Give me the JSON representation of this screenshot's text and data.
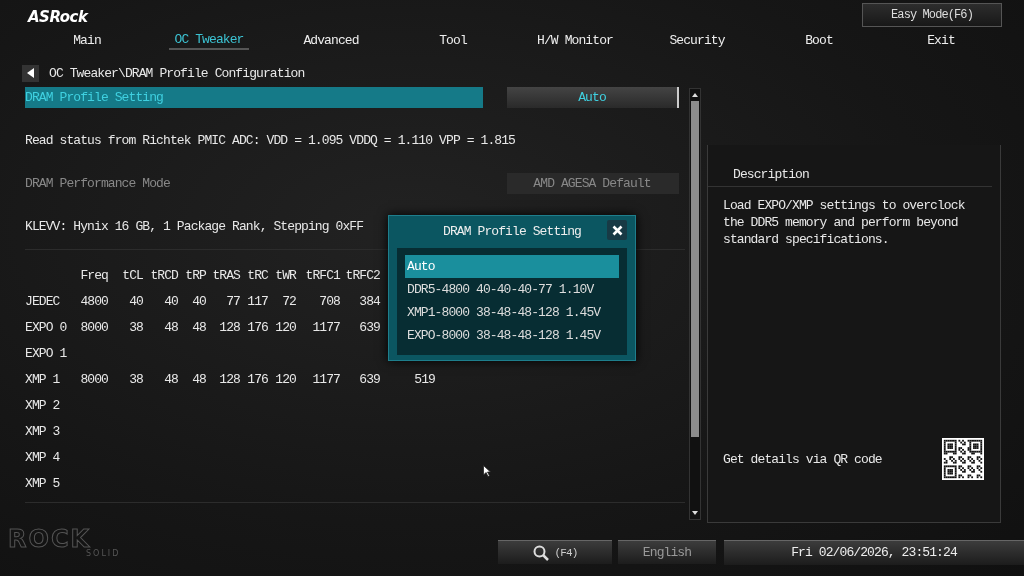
{
  "brand": {
    "logo": "ASRock",
    "footer_logo": "ROCK",
    "footer_tagline": "SOLID"
  },
  "easy_mode_button": "Easy Mode(F6)",
  "tabs": [
    {
      "label": "Main",
      "selected": false
    },
    {
      "label": "OC Tweaker",
      "selected": true
    },
    {
      "label": "Advanced",
      "selected": false
    },
    {
      "label": "Tool",
      "selected": false
    },
    {
      "label": "H/W Monitor",
      "selected": false
    },
    {
      "label": "Security",
      "selected": false
    },
    {
      "label": "Boot",
      "selected": false
    },
    {
      "label": "Exit",
      "selected": false
    }
  ],
  "breadcrumb": "OC Tweaker\\DRAM Profile Configuration",
  "settings": [
    {
      "kind": "option",
      "label": "DRAM Profile Setting",
      "value": "Auto",
      "selected": true,
      "disabled": false
    },
    {
      "kind": "info",
      "text": "Read status from Richtek PMIC ADC: VDD = 1.095 VDDQ = 1.110 VPP = 1.815"
    },
    {
      "kind": "option",
      "label": "DRAM Performance Mode",
      "value": "AMD AGESA Default",
      "selected": false,
      "disabled": true
    },
    {
      "kind": "info",
      "text": "KLEVV: Hynix 16 GB, 1 Package Rank, Stepping 0xFF"
    }
  ],
  "table": {
    "columns": [
      "",
      "Freq",
      "tCL",
      "tRCD",
      "tRP",
      "tRAS",
      "tRC",
      "tWR",
      "tRFC1",
      "tRFC2"
    ],
    "rows": [
      {
        "cells": [
          "JEDEC",
          "4800",
          "40",
          "40",
          "40",
          "77",
          "117",
          "72",
          "708",
          "384"
        ]
      },
      {
        "cells": [
          "EXPO 0",
          "8000",
          "38",
          "48",
          "48",
          "128",
          "176",
          "120",
          "1177",
          "639"
        ]
      },
      {
        "cells": [
          "EXPO 1"
        ]
      },
      {
        "cells": [
          "XMP 1",
          "8000",
          "38",
          "48",
          "48",
          "128",
          "176",
          "120",
          "1177",
          "639",
          "519"
        ]
      },
      {
        "cells": [
          "XMP 2"
        ]
      },
      {
        "cells": [
          "XMP 3"
        ]
      },
      {
        "cells": [
          "XMP 4"
        ]
      },
      {
        "cells": [
          "XMP 5"
        ]
      }
    ]
  },
  "popup": {
    "title": "DRAM Profile Setting",
    "options": [
      {
        "label": "Auto",
        "selected": true
      },
      {
        "label": "DDR5-4800 40-40-40-77 1.10V",
        "selected": false
      },
      {
        "label": "XMP1-8000 38-48-48-128 1.45V",
        "selected": false
      },
      {
        "label": "EXPO-8000 38-48-48-128 1.45V",
        "selected": false
      }
    ]
  },
  "description": {
    "title": "Description",
    "text": "Load EXPO/XMP settings to overclock the DDR5 memory and perform beyond standard specifications.",
    "qr_caption": "Get details via QR code"
  },
  "status_bar": {
    "search_key": "(F4)",
    "language": "English",
    "datetime": "Fri 02/06/2026, 23:51:24"
  }
}
